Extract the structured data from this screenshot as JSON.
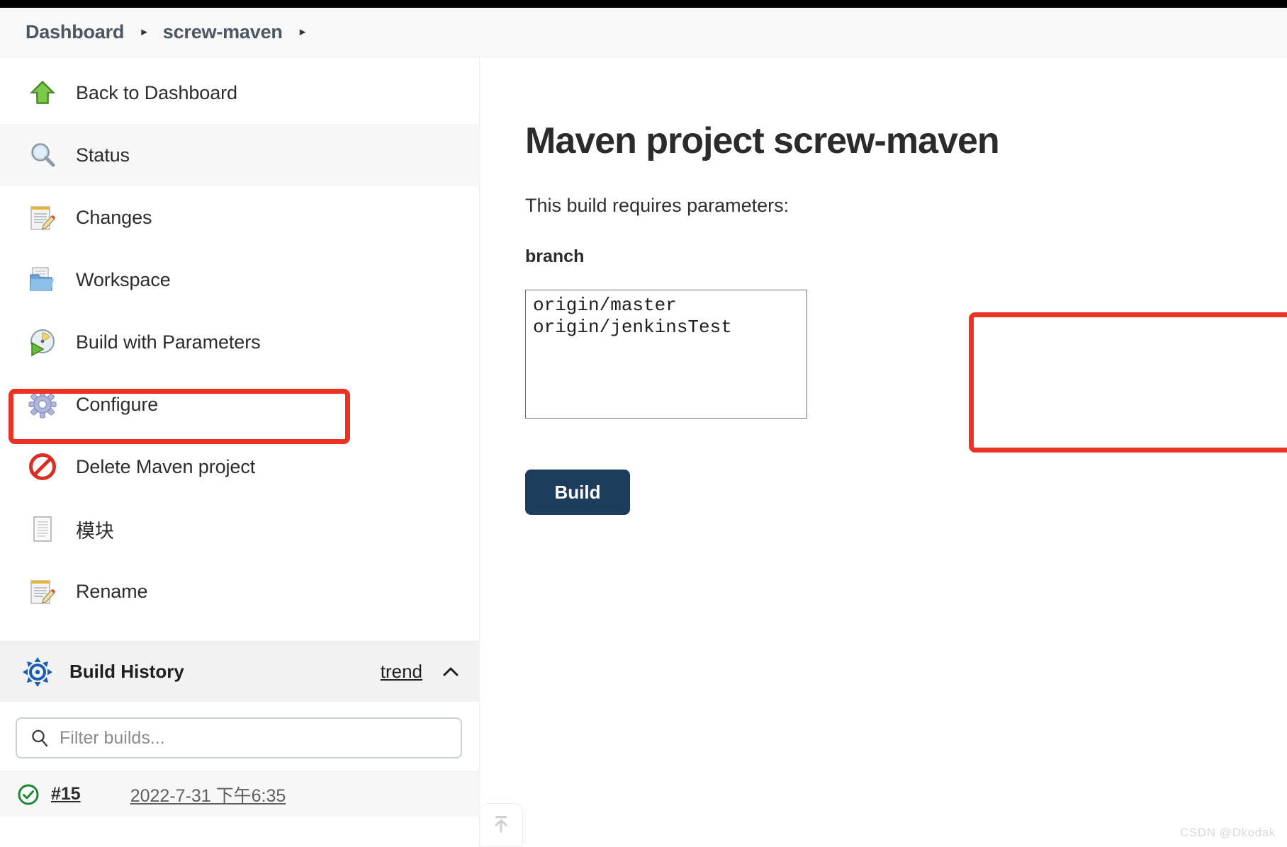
{
  "breadcrumb": {
    "items": [
      {
        "label": "Dashboard"
      },
      {
        "label": "screw-maven"
      }
    ],
    "separator": "▸"
  },
  "sidebar": {
    "tasks": [
      {
        "label": "Back to Dashboard",
        "icon": "up-arrow-icon"
      },
      {
        "label": "Status",
        "icon": "magnifier-icon"
      },
      {
        "label": "Changes",
        "icon": "notepad-pencil-icon"
      },
      {
        "label": "Workspace",
        "icon": "folder-icon"
      },
      {
        "label": "Build with Parameters",
        "icon": "clock-play-icon"
      },
      {
        "label": "Configure",
        "icon": "gear-icon"
      },
      {
        "label": "Delete Maven project",
        "icon": "no-entry-icon"
      },
      {
        "label": "模块",
        "icon": "document-icon"
      },
      {
        "label": "Rename",
        "icon": "notepad-pencil-icon"
      }
    ],
    "build_history": {
      "title": "Build History",
      "trend_label": "trend",
      "collapse_icon": "chevron-up-icon",
      "weather_icon": "jenkins-weather-icon",
      "filter": {
        "placeholder": "Filter builds...",
        "value": "",
        "icon": "search-icon"
      },
      "builds": [
        {
          "number": "#15",
          "timestamp": "2022-7-31 下午6:35",
          "status": "success",
          "status_icon": "check-circle-icon"
        }
      ]
    }
  },
  "main": {
    "title": "Maven project screw-maven",
    "requires_text": "This build requires parameters:",
    "parameter": {
      "label": "branch",
      "options": [
        "origin/master",
        "origin/jenkinsTest"
      ],
      "selected": ""
    },
    "build_button": "Build"
  },
  "annotations": [
    {
      "name": "sidebar-highlight",
      "color": "#ea3323"
    },
    {
      "name": "parameter-highlight",
      "color": "#ea3323"
    }
  ],
  "scroll_top": {
    "icon": "scroll-to-top-icon"
  },
  "watermark": "CSDN @Dkodak"
}
